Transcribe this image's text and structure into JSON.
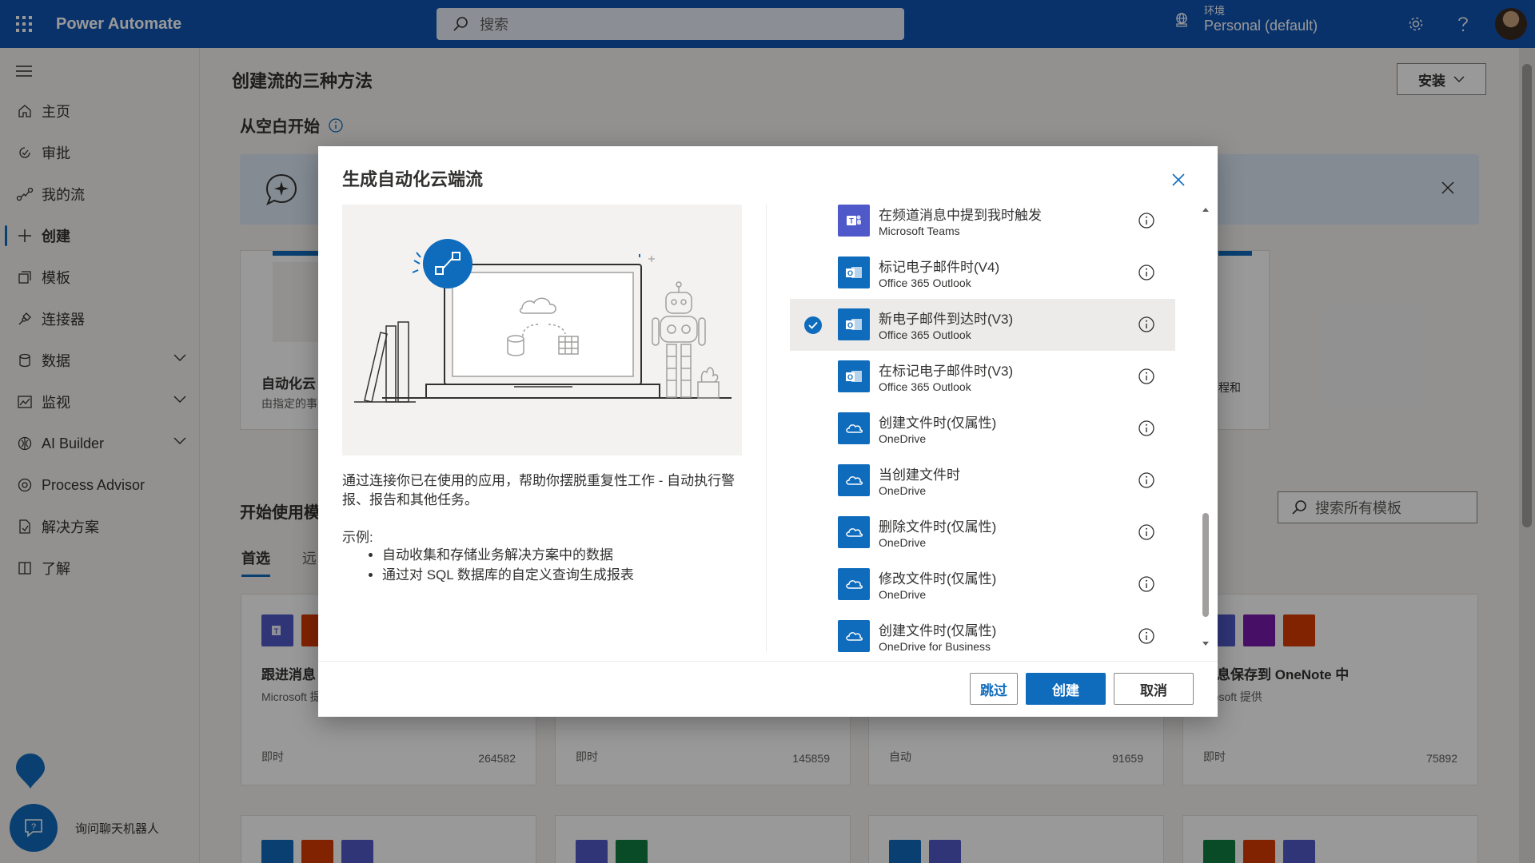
{
  "topbar": {
    "app_title": "Power Automate",
    "search_placeholder": "搜索",
    "env_label": "环境",
    "env_name": "Personal (default)"
  },
  "sidebar": {
    "items": [
      {
        "label": "主页",
        "icon": "home-icon"
      },
      {
        "label": "审批",
        "icon": "approvals-icon"
      },
      {
        "label": "我的流",
        "icon": "flow-icon"
      },
      {
        "label": "创建",
        "icon": "plus-icon"
      },
      {
        "label": "模板",
        "icon": "templates-icon"
      },
      {
        "label": "连接器",
        "icon": "connector-icon"
      },
      {
        "label": "数据",
        "icon": "database-icon"
      },
      {
        "label": "监视",
        "icon": "monitor-icon"
      },
      {
        "label": "AI Builder",
        "icon": "ai-builder-icon"
      },
      {
        "label": "Process Advisor",
        "icon": "process-advisor-icon"
      },
      {
        "label": "解决方案",
        "icon": "solutions-icon"
      },
      {
        "label": "了解",
        "icon": "book-icon"
      }
    ],
    "chatbot_label": "询问聊天机器人"
  },
  "page": {
    "title": "创建流的三种方法",
    "install_label": "安装",
    "blank_title": "从空白开始",
    "card_title_partial": "自动化云",
    "card_sub_partial": "由指定的事",
    "card_right_partial": "程和",
    "templates_title_partial": "开始使用模",
    "template_search_placeholder": "搜索所有模板",
    "tab_featured": "首选",
    "tab_remote_partial": "远",
    "templates": [
      {
        "name": "跟进消息",
        "by": "Microsoft 提",
        "type": "即时",
        "count": "264582"
      },
      {
        "name": "",
        "by": "",
        "type": "即时",
        "count": "145859"
      },
      {
        "name": "",
        "by": "",
        "type": "自动",
        "count": "91659"
      },
      {
        "name": "消息保存到 OneNote 中",
        "by": "crosoft 提供",
        "type": "即时",
        "count": "75892"
      }
    ]
  },
  "dialog": {
    "title": "生成自动化云端流",
    "description": "通过连接你已在使用的应用，帮助你摆脱重复性工作 - 自动执行警报、报告和其他任务。",
    "example_label": "示例:",
    "bullets": [
      "自动收集和存储业务解决方案中的数据",
      "通过对 SQL 数据库的自定义查询生成报表"
    ],
    "triggers": [
      {
        "name": "在频道消息中提到我时触发",
        "connector": "Microsoft Teams",
        "app": "teams",
        "selected": false
      },
      {
        "name": "标记电子邮件时(V4)",
        "connector": "Office 365 Outlook",
        "app": "outlook",
        "selected": false
      },
      {
        "name": "新电子邮件到达时(V3)",
        "connector": "Office 365 Outlook",
        "app": "outlook",
        "selected": true
      },
      {
        "name": "在标记电子邮件时(V3)",
        "connector": "Office 365 Outlook",
        "app": "outlook",
        "selected": false
      },
      {
        "name": "创建文件时(仅属性)",
        "connector": "OneDrive",
        "app": "onedrive",
        "selected": false
      },
      {
        "name": "当创建文件时",
        "connector": "OneDrive",
        "app": "onedrive",
        "selected": false
      },
      {
        "name": "删除文件时(仅属性)",
        "connector": "OneDrive",
        "app": "onedrive",
        "selected": false
      },
      {
        "name": "修改文件时(仅属性)",
        "connector": "OneDrive",
        "app": "onedrive",
        "selected": false
      },
      {
        "name": "创建文件时(仅属性)",
        "connector": "OneDrive for Business",
        "app": "onedrive",
        "selected": false
      }
    ],
    "skip_label": "跳过",
    "create_label": "创建",
    "cancel_label": "取消"
  },
  "colors": {
    "brand_blue": "#0f54b3",
    "primary": "#0f6cbd",
    "teams": "#5059c9",
    "outlook": "#0f6cbd",
    "onedrive": "#0f6cbd",
    "office": "#d83b01",
    "onenote": "#7719aa",
    "excel": "#107c41"
  }
}
